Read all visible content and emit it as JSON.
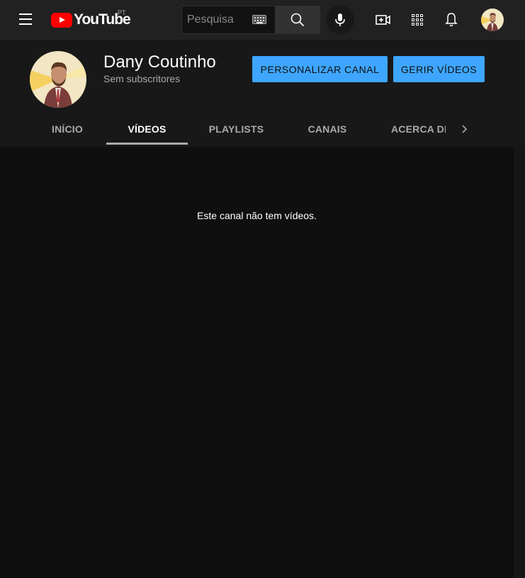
{
  "header": {
    "logo_text": "YouTube",
    "country_code": "PT",
    "search": {
      "placeholder": "Pesquisa",
      "value": ""
    }
  },
  "icons": {
    "menu": "menu-icon",
    "keyboard": "keyboard-icon",
    "search": "search-icon",
    "mic": "microphone-icon",
    "create": "create-video-icon",
    "apps": "apps-grid-icon",
    "notifications": "bell-icon"
  },
  "channel": {
    "name": "Dany Coutinho",
    "subscribers": "Sem subscritores",
    "customize_label": "PERSONALIZAR CANAL",
    "manage_label": "GERIR VÍDEOS"
  },
  "tabs": [
    {
      "label": "INÍCIO",
      "active": false
    },
    {
      "label": "VÍDEOS",
      "active": true
    },
    {
      "label": "PLAYLISTS",
      "active": false
    },
    {
      "label": "CANAIS",
      "active": false
    },
    {
      "label": "ACERCA DE",
      "active": false
    }
  ],
  "content": {
    "empty_message": "Este canal não tem vídeos."
  },
  "colors": {
    "accent": "#3ea6ff",
    "brand_red": "#ff0000",
    "background": "#0f0f0f",
    "header_bg": "#181818",
    "topbar_bg": "#212121"
  }
}
